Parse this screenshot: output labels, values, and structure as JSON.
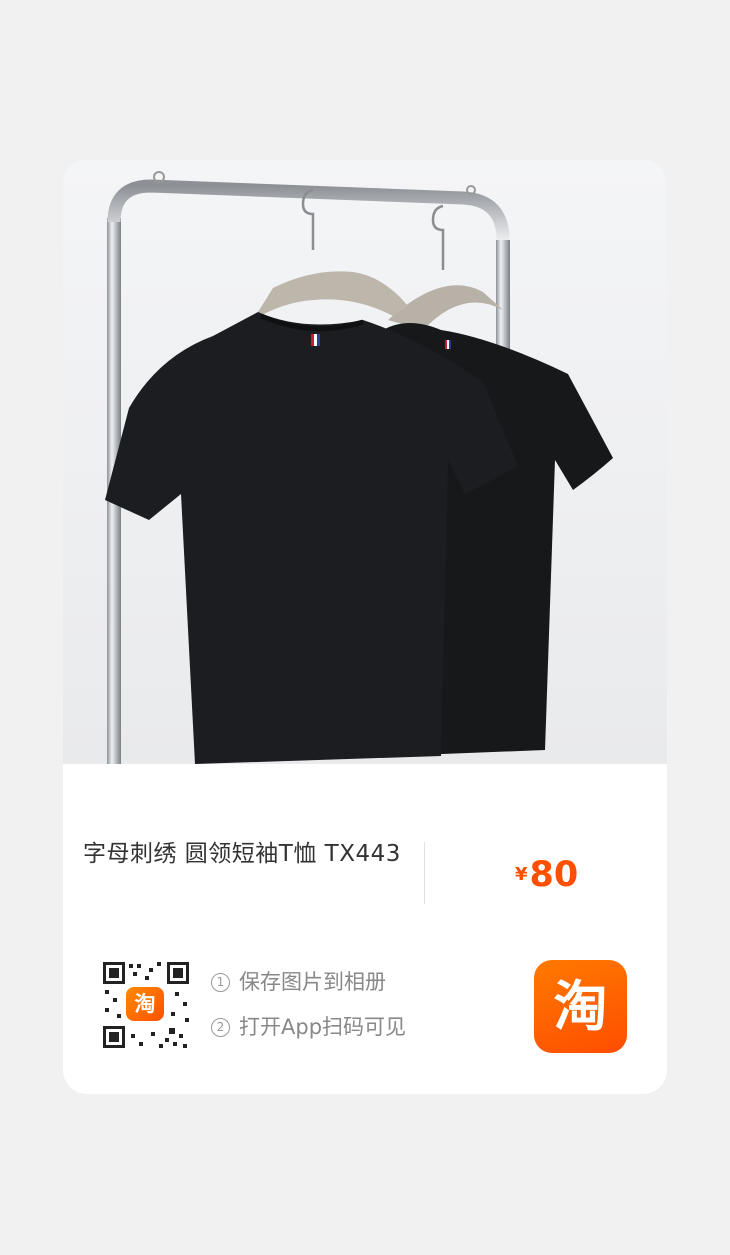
{
  "product": {
    "title": "字母刺绣 圆领短袖T恤 TX443",
    "currency_symbol": "¥",
    "price": "80",
    "image_icon": "t-shirt-photo"
  },
  "share": {
    "qr_logo_text": "淘",
    "step1_num": "1",
    "step1": "保存图片到相册",
    "step2_num": "2",
    "step2": "打开App扫码可见",
    "app_icon_text": "淘"
  },
  "colors": {
    "accent": "#ff5000",
    "card": "#ffffff",
    "background": "#f1f1f2"
  }
}
